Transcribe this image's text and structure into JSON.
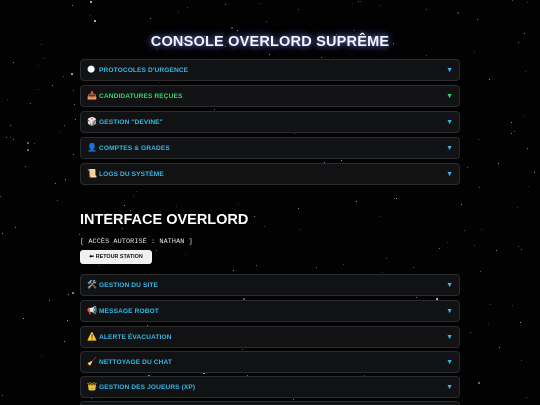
{
  "console": {
    "title": "CONSOLE OVERLORD SUPRÊME",
    "sections": [
      {
        "icon": "🌑",
        "icon_name": "dark-moon-icon",
        "label": "PROTOCOLES D'URGENCE",
        "color": "blue"
      },
      {
        "icon": "📥",
        "icon_name": "inbox-tray-icon",
        "label": "CANDIDATURES REÇUES",
        "color": "green"
      },
      {
        "icon": "🎲",
        "icon_name": "dice-icon",
        "label": "GESTION \"DEVINE\"",
        "color": "blue"
      },
      {
        "icon": "👤",
        "icon_name": "user-icon",
        "label": "COMPTES & GRADES",
        "color": "blue"
      },
      {
        "icon": "📜",
        "icon_name": "scroll-icon",
        "label": "LOGS DU SYSTÈME",
        "color": "blue"
      }
    ]
  },
  "interface": {
    "title": "INTERFACE OVERLORD",
    "access_text": "[ ACCÈS AUTORISÉ : NATHAN ]",
    "return_button": {
      "icon": "⬅",
      "label": "RETOUR STATION"
    },
    "sections": [
      {
        "icon": "🛠️",
        "icon_name": "tools-icon",
        "label": "GESTION DU SITE"
      },
      {
        "icon": "📢",
        "icon_name": "megaphone-icon",
        "label": "MESSAGE ROBOT"
      },
      {
        "icon": "⚠️",
        "icon_name": "warning-icon",
        "label": "ALERTE ÉVACUATION"
      },
      {
        "icon": "🧹",
        "icon_name": "broom-icon",
        "label": "NETTOYAGE DU CHAT"
      },
      {
        "icon": "👑",
        "icon_name": "crown-icon",
        "label": "GESTION DES JOUEURS (XP)"
      }
    ]
  },
  "toggle_arrow": "▼",
  "colors": {
    "blue": "#35b8ea",
    "green": "#35d46a",
    "panel_bg": "#111214",
    "panel_border": "#2a2c30"
  }
}
